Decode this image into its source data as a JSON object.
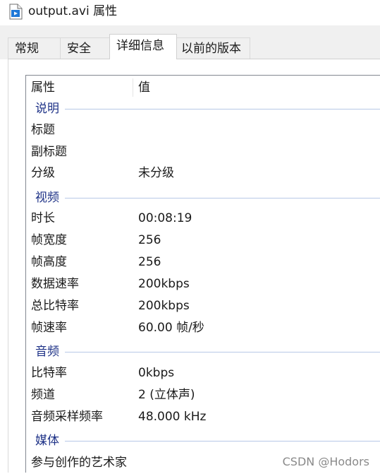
{
  "window": {
    "title": "output.avi 属性",
    "icon": "video-file-icon"
  },
  "tabs": [
    {
      "label": "常规",
      "active": false
    },
    {
      "label": "安全",
      "active": false
    },
    {
      "label": "详细信息",
      "active": true
    },
    {
      "label": "以前的版本",
      "active": false
    }
  ],
  "details": {
    "header": {
      "name": "属性",
      "value": "值"
    },
    "groups": {
      "description": "说明",
      "video": "视频",
      "audio": "音频",
      "media": "媒体"
    },
    "rows": {
      "title": {
        "name": "标题",
        "value": ""
      },
      "subtitle": {
        "name": "副标题",
        "value": ""
      },
      "rating": {
        "name": "分级",
        "value": "未分级"
      },
      "duration": {
        "name": "时长",
        "value": "00:08:19"
      },
      "frame_width": {
        "name": "帧宽度",
        "value": "256"
      },
      "frame_height": {
        "name": "帧高度",
        "value": "256"
      },
      "data_rate": {
        "name": "数据速率",
        "value": "200kbps"
      },
      "total_bitrate": {
        "name": "总比特率",
        "value": "200kbps"
      },
      "frame_rate": {
        "name": "帧速率",
        "value": "60.00 帧/秒"
      },
      "audio_bitrate": {
        "name": "比特率",
        "value": "0kbps"
      },
      "channels": {
        "name": "频道",
        "value": "2 (立体声)"
      },
      "sample_rate": {
        "name": "音频采样频率",
        "value": "48.000 kHz"
      },
      "contributing_artists": {
        "name": "参与创作的艺术家",
        "value": ""
      }
    }
  },
  "watermark": "CSDN @Hodors",
  "colors": {
    "group_text": "#1e3287",
    "group_line": "#b7c8e6",
    "icon_blue": "#1e78d7"
  }
}
